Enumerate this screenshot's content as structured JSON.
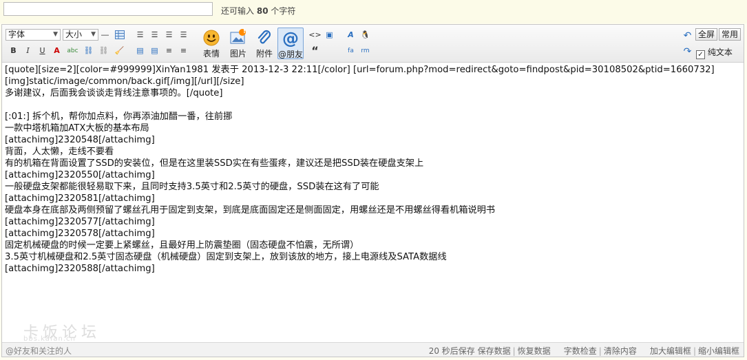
{
  "subject": {
    "value": "",
    "remaining_prefix": "还可输入",
    "remaining_count": "80",
    "remaining_suffix": "个字符"
  },
  "toolbar": {
    "font_select": "字体",
    "size_select": "大小",
    "emoji_label": "表情",
    "image_label": "图片",
    "image_badge": "!",
    "attach_label": "附件",
    "mention_label": "@朋友",
    "quote_glyph": "“",
    "fullscreen_label": "全屏",
    "common_label": "常用",
    "plaintext_label": "纯文本"
  },
  "content": {
    "lines": [
      "[quote][size=2][color=#999999]XinYan1981 发表于 2013-12-3 22:11[/color] [url=forum.php?mod=redirect&goto=findpost&pid=30108502&ptid=1660732]",
      "[img]static/image/common/back.gif[/img][/url][/size]",
      "多谢建议，后面我会谈谈走背线注意事项的。[/quote]",
      "",
      "[:01:] 拆个机，帮你加点料，你再添油加醋一番，往前挪",
      "一款中塔机箱加ATX大板的基本布局",
      "[attachimg]2320548[/attachimg]",
      "背面，人太懒，走线不要看",
      "有的机箱在背面设置了SSD的安装位，但是在这里装SSD实在有些蛋疼，建议还是把SSD装在硬盘支架上",
      "[attachimg]2320550[/attachimg]",
      "一般硬盘支架都能很轻易取下来，且同时支持3.5英寸和2.5英寸的硬盘，SSD装在这有了可能",
      "[attachimg]2320581[/attachimg]",
      "硬盘本身在底部及两侧预留了螺丝孔用于固定到支架，到底是底面固定还是侧面固定，用螺丝还是不用螺丝得看机箱说明书",
      "[attachimg]2320577[/attachimg]",
      "[attachimg]2320578[/attachimg]",
      "固定机械硬盘的时候一定要上紧螺丝，且最好用上防震垫圈（固态硬盘不怕震，无所谓）",
      "3.5英寸机械硬盘和2.5英寸固态硬盘（机械硬盘）固定到支架上，放到该放的地方，接上电源线及SATA数据线",
      "[attachimg]2320588[/attachimg]"
    ]
  },
  "status": {
    "left": "@好友和关注的人",
    "autosave": "20 秒后保存",
    "save": "保存数据",
    "restore": "恢复数据",
    "check": "字数检查",
    "clear": "清除内容",
    "enlarge": "加大编辑框",
    "shrink": "缩小编辑框"
  },
  "watermark": {
    "text": "卡饭论坛",
    "sub": "bbs.kafan.cn"
  },
  "colors": {
    "accent": "#2a6fc0",
    "emoji": "#f5a623",
    "border": "#c6c6c6"
  }
}
